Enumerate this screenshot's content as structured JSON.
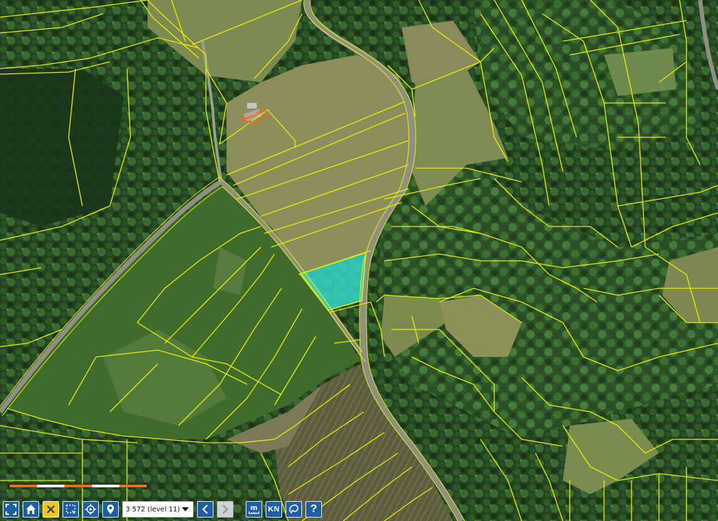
{
  "map": {
    "view": "cadastral-orthophoto",
    "colors": {
      "parcel_line": "#e8f000",
      "selected_parcel_fill": "#35d6c6",
      "road": "#8d8f86",
      "forest_dark": "#1e3a1c",
      "meadow": "#7f8a53",
      "crop_field": "#3f6a2c"
    },
    "selected_parcel": {
      "icon": "highlighted-parcel"
    }
  },
  "scalebar": {
    "colors": [
      "#ef6b1c",
      "#ffffff",
      "#ef6b1c",
      "#ffffff",
      "#ef6b1c"
    ]
  },
  "toolbar": {
    "buttons": [
      {
        "id": "fullscreen",
        "icon": "fullscreen-icon"
      },
      {
        "id": "home",
        "icon": "home-icon"
      },
      {
        "id": "clear",
        "icon": "close-icon",
        "active": true
      },
      {
        "id": "select-area",
        "icon": "select-area-icon"
      },
      {
        "id": "locate",
        "icon": "target-icon"
      },
      {
        "id": "place",
        "icon": "map-pin-icon"
      }
    ],
    "level_select": {
      "value": "3 572 (level 11)"
    },
    "nav": [
      {
        "id": "back",
        "icon": "chevron-left-icon",
        "enabled": true
      },
      {
        "id": "forward",
        "icon": "chevron-right-icon",
        "enabled": false
      }
    ],
    "tools": [
      {
        "id": "measure",
        "label": "m",
        "icon": "measure-icon"
      },
      {
        "id": "cadastre",
        "label": "KN"
      },
      {
        "id": "draw",
        "icon": "lasso-icon"
      },
      {
        "id": "help",
        "label": "?"
      }
    ]
  }
}
